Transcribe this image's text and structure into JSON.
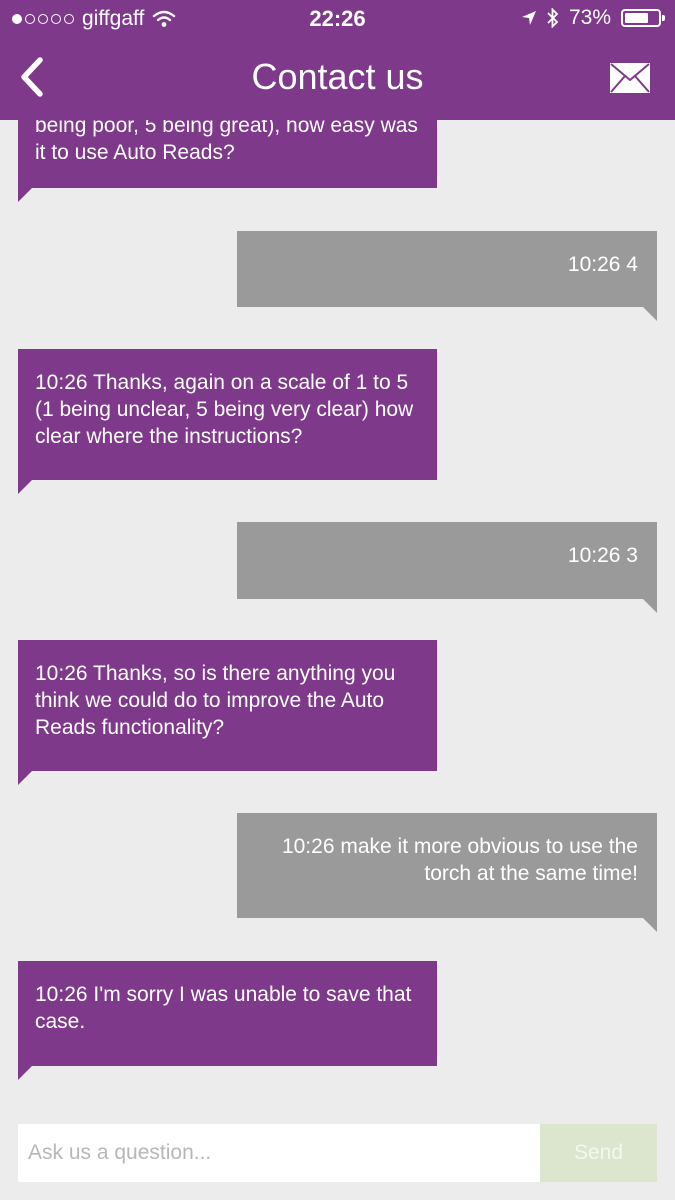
{
  "status_bar": {
    "carrier": "giffgaff",
    "signal_bars_filled": 1,
    "signal_bars_total": 5,
    "time": "22:26",
    "battery_percent": "73%",
    "battery_level": 0.73
  },
  "header": {
    "title": "Contact us",
    "back_icon": "chevron-left-icon",
    "action_icon": "envelope-icon"
  },
  "messages": [
    {
      "sender": "agent",
      "text": "being poor, 5 being great), how easy was it to use Auto Reads?"
    },
    {
      "sender": "user",
      "text": "10:26 4"
    },
    {
      "sender": "agent",
      "text": "10:26 Thanks, again on a scale of 1 to 5 (1 being unclear, 5 being very clear) how clear where the instructions?"
    },
    {
      "sender": "user",
      "text": "10:26 3"
    },
    {
      "sender": "agent",
      "text": "10:26 Thanks, so is there anything you think we could do to improve the Auto Reads functionality?"
    },
    {
      "sender": "user",
      "text": "10:26 make it more obvious to use the torch at the same time!"
    },
    {
      "sender": "agent",
      "text": "10:26 I'm sorry I was unable to save that case."
    }
  ],
  "composer": {
    "placeholder": "Ask us a question...",
    "value": "",
    "send_label": "Send"
  },
  "colors": {
    "brand": "#7e398b",
    "user_bubble": "#9a9a9a",
    "background": "#ececec",
    "send_disabled": "#dce5cd"
  }
}
